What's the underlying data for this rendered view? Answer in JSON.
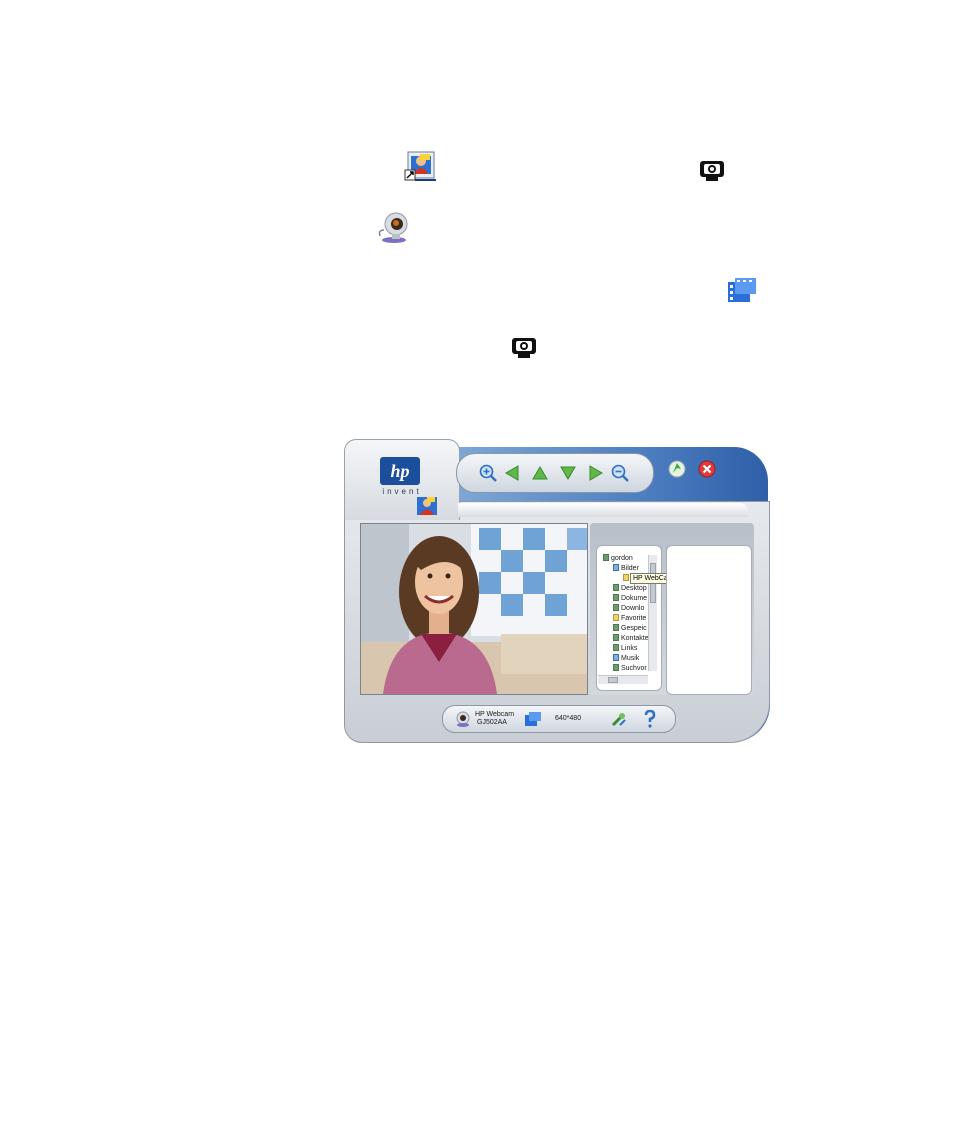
{
  "icons": {
    "app_shortcut": "hp-photo-app-shortcut-icon",
    "snapshot_top": "snapshot-camera-icon",
    "webcam": "webcam-icon",
    "video": "video-clip-icon",
    "snapshot_lower": "snapshot-camera-icon"
  },
  "window": {
    "logo": {
      "brand": "hp",
      "tagline": "invent"
    },
    "toolbar": [
      "zoom-in-icon",
      "arrow-left-icon",
      "arrow-up-icon",
      "arrow-down-icon",
      "arrow-right-icon",
      "zoom-out-icon"
    ],
    "refresh_button": "refresh-icon",
    "close_button": "close-icon",
    "tree": {
      "items": [
        {
          "label": "gordon",
          "level": 0,
          "icon": "green"
        },
        {
          "label": "Bilder",
          "level": 1,
          "icon": "blue"
        },
        {
          "label": "",
          "level": 2,
          "icon": "yellow"
        },
        {
          "label": "Desktop",
          "level": 1,
          "icon": "green"
        },
        {
          "label": "Dokume",
          "level": 1,
          "icon": "green"
        },
        {
          "label": "Downlo",
          "level": 1,
          "icon": "green"
        },
        {
          "label": "Favorite",
          "level": 1,
          "icon": "yellow"
        },
        {
          "label": "Gespeic",
          "level": 1,
          "icon": "green"
        },
        {
          "label": "Kontakte",
          "level": 1,
          "icon": "green"
        },
        {
          "label": "Links",
          "level": 1,
          "icon": "green"
        },
        {
          "label": "Musik",
          "level": 1,
          "icon": "blue"
        },
        {
          "label": "Suchvor",
          "level": 1,
          "icon": "green"
        }
      ],
      "tooltip": "HP WebCam"
    },
    "status": {
      "device_name": "HP Webcam",
      "device_model": "GJ502AA",
      "resolution": "640*480"
    },
    "colors": {
      "accent": "#3a6db6",
      "close": "#e03a3a",
      "refresh": "#3fa83f"
    }
  }
}
